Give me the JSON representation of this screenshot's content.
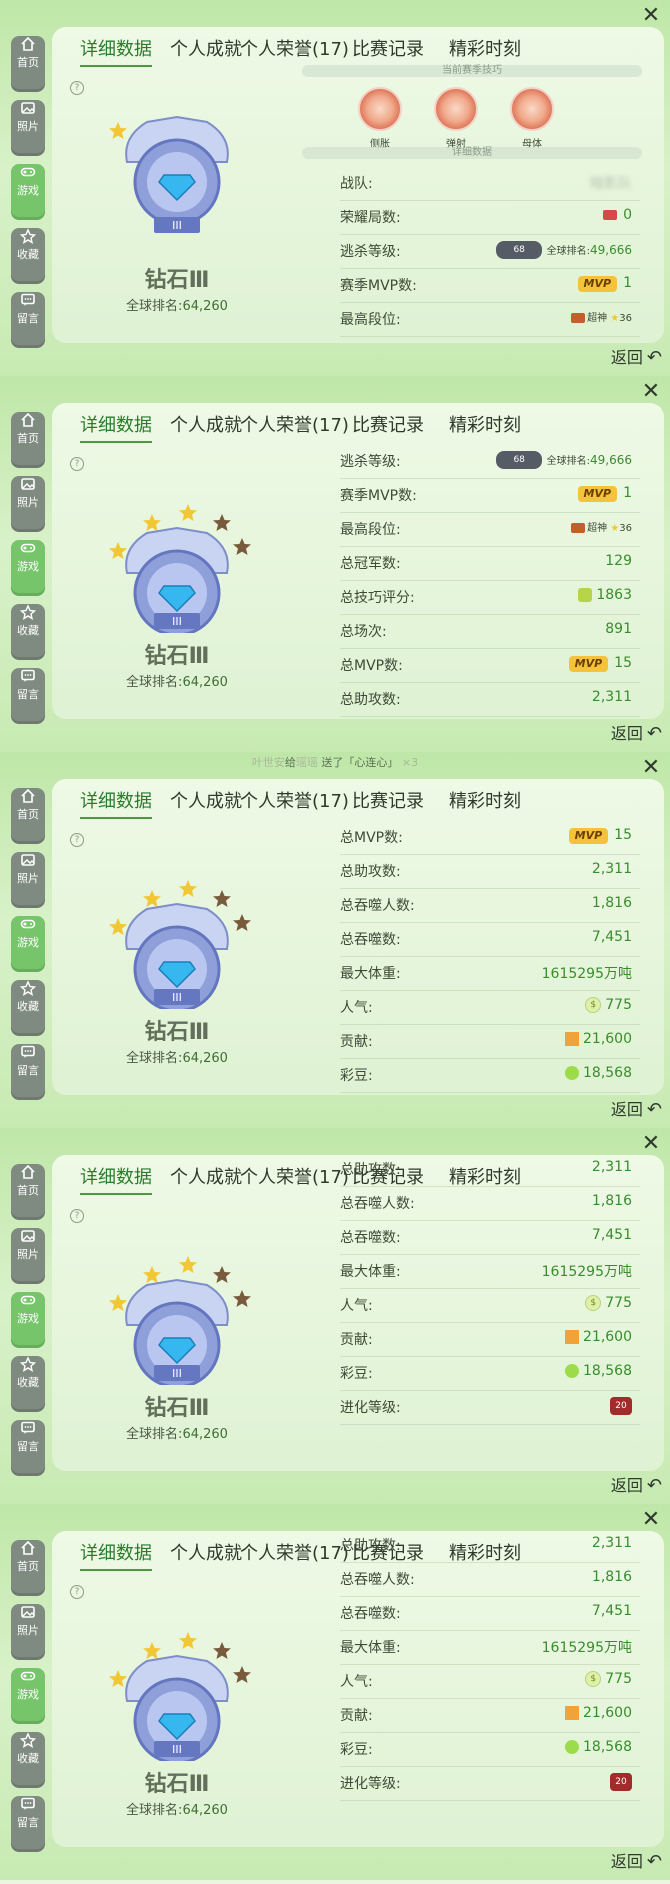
{
  "tabs": [
    "详细数据",
    "个人成就",
    "个人荣誉(17)",
    "比赛记录",
    "精彩时刻"
  ],
  "sidebar": [
    "首页",
    "照片",
    "游戏",
    "收藏",
    "留言"
  ],
  "help": "?",
  "rank": {
    "name": "钻石Ⅲ",
    "global_label": "全球排名:",
    "global_value": "64,260",
    "badge_numeral": "III"
  },
  "back_label": "返回",
  "close": "✕",
  "season_skills_title": "当前赛季技巧",
  "detail_title": "详细数据",
  "skills": [
    "侧胀",
    "弹射",
    "母体"
  ],
  "gift_banner": {
    "a": "叶世安",
    "b": "给",
    "c": "瑶瑶",
    "d": "送了「心连心」",
    "e": "×3"
  },
  "stats": {
    "team": {
      "label": "战队:",
      "value": "暗影队"
    },
    "honor_games": {
      "label": "荣耀局数:",
      "value": "0"
    },
    "kill_level": {
      "label": "逃杀等级:",
      "value": "68",
      "rank_label": "全球排名:",
      "rank_value": "49,666"
    },
    "season_mvp": {
      "label": "赛季MVP数:",
      "badge": "MVP",
      "value": "1"
    },
    "highest_tier": {
      "label": "最高段位:",
      "tier": "超神",
      "stars": "36"
    },
    "champion_total": {
      "label": "总冠军数:",
      "value": "129"
    },
    "skill_score": {
      "label": "总技巧评分:",
      "value": "1863"
    },
    "games_total": {
      "label": "总场次:",
      "value": "891"
    },
    "mvp_total": {
      "label": "总MVP数:",
      "badge": "MVP",
      "value": "15"
    },
    "assists_total": {
      "label": "总助攻数:",
      "value": "2,311"
    },
    "devoured_players": {
      "label": "总吞噬人数:",
      "value": "1,816"
    },
    "devoured_total": {
      "label": "总吞噬数:",
      "value": "7,451"
    },
    "max_weight": {
      "label": "最大体重:",
      "value": "1615295万吨"
    },
    "popularity": {
      "label": "人气:",
      "value": "775"
    },
    "contribution": {
      "label": "贡献:",
      "value": "21,600"
    },
    "beans": {
      "label": "彩豆:",
      "value": "18,568"
    },
    "evolution": {
      "label": "进化等级:",
      "value": "20"
    }
  }
}
